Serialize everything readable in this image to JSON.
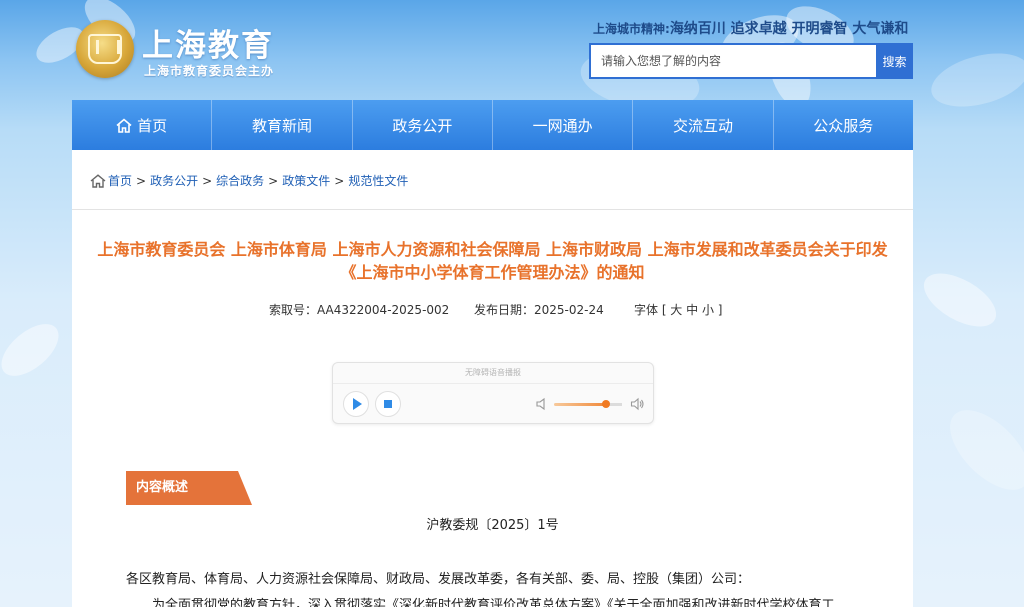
{
  "header": {
    "site_title": "上海教育",
    "site_subtitle": "上海市教育委员会主办",
    "slogan_lead": "上海城市精神:",
    "slogan_main": "海纳百川 追求卓越 开明睿智 大气谦和",
    "search_placeholder": "请输入您想了解的内容",
    "search_button": "搜索"
  },
  "nav": {
    "items": [
      "首页",
      "教育新闻",
      "政务公开",
      "一网通办",
      "交流互动",
      "公众服务"
    ]
  },
  "breadcrumb": {
    "items": [
      "首页",
      "政务公开",
      "综合政务",
      "政策文件",
      "规范性文件"
    ],
    "separator": ">"
  },
  "document": {
    "title": "上海市教育委员会 上海市体育局 上海市人力资源和社会保障局 上海市财政局 上海市发展和改革委员会关于印发《上海市中小学体育工作管理办法》的通知",
    "index_no": "索取号：AA4322004-2025-002",
    "publish_date": "发布日期：2025-02-24",
    "font_size_label": "字体 [ 大 中 小 ]",
    "section_tag": "内容概述",
    "doc_number": "沪教委规〔2025〕1号",
    "salutation": "各区教育局、体育局、人力资源社会保障局、财政局、发展改革委，各有关部、委、局、控股（集团）公司：",
    "body_first_line": "为全面贯彻党的教育方针，深入贯彻落实《深化新时代教育评价改革总体方案》《关于全面加强和改进新时代学校体育工"
  },
  "player": {
    "title": "无障碍语音播报",
    "volume": 0.76
  },
  "colors": {
    "nav_blue": "#2c7ddf",
    "title_orange": "#e8722b",
    "tag_orange": "#e4733a",
    "link_blue": "#1f5fb5"
  },
  "icons": {
    "home": "home-icon",
    "play": "play-icon",
    "stop": "stop-icon",
    "mute": "volume-mute-icon",
    "volume": "volume-up-icon"
  }
}
